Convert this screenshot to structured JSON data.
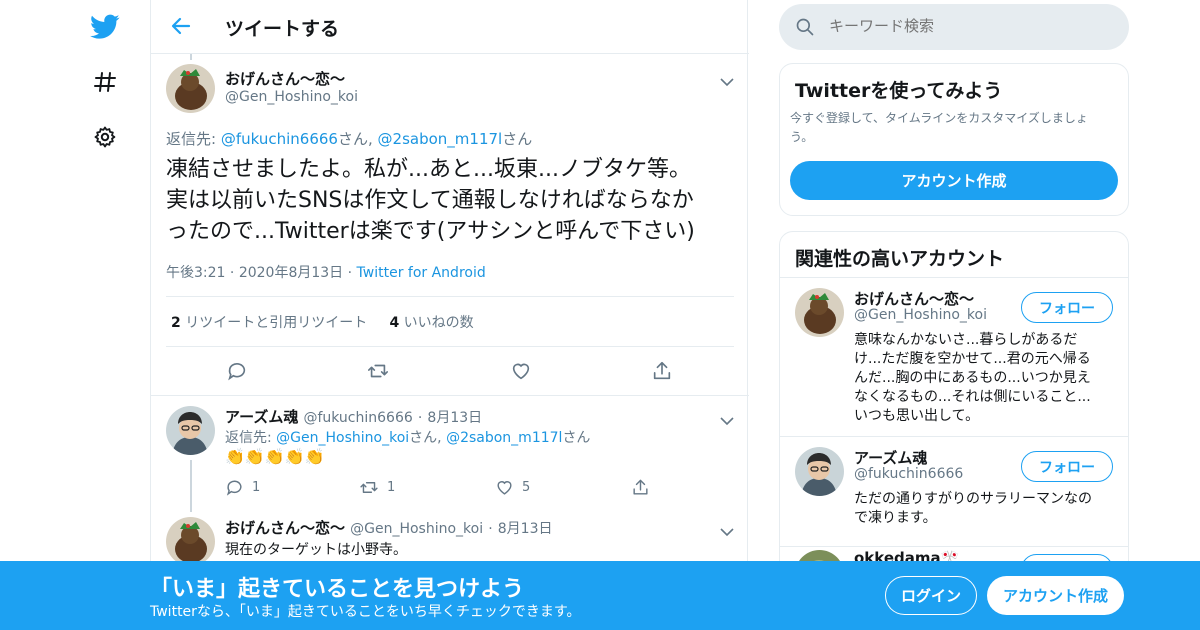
{
  "colors": {
    "accent": "#1da1f2",
    "link": "#1b95e0",
    "muted": "#657786",
    "border": "#e6ecf0"
  },
  "nav": {
    "icons": [
      "twitter-bird-icon",
      "hashtag-icon",
      "gear-icon"
    ]
  },
  "header": {
    "title": "ツイートする"
  },
  "focus_tweet": {
    "name": "おげんさん〜恋〜",
    "handle": "@Gen_Hoshino_koi",
    "reply_label": "返信先:",
    "reply_user1": "@fukuchin6666",
    "reply_sep": "さん,",
    "reply_user2": "@2sabon_m117l",
    "reply_suffix": "さん",
    "text_line1": "凍結させましたよ。私が...あと...坂東...ノブタケ等。",
    "text_line2": "実は以前いたSNSは作文して通報しなければならなか",
    "text_line3": "ったので...Twitterは楽です(アサシンと呼んで下さい)",
    "time": "午後3:21",
    "date": "2020年8月13日",
    "dot": "·",
    "source": "Twitter for Android",
    "retweet_count": "2",
    "retweet_label": "リツイートと引用リツイート",
    "like_count": "4",
    "like_label": "いいねの数"
  },
  "replies": [
    {
      "name": "アーズム魂",
      "handle": "@fukuchin6666",
      "date": "8月13日",
      "reply_label": "返信先:",
      "reply_user1": "@Gen_Hoshino_koi",
      "reply_sep": "さん,",
      "reply_user2": "@2sabon_m117l",
      "reply_suffix": "さん",
      "text": "👏👏👏👏👏",
      "reply_count": "1",
      "retweet_count": "1",
      "like_count": "5"
    },
    {
      "name": "おげんさん〜恋〜",
      "handle": "@Gen_Hoshino_koi",
      "date": "8月13日",
      "text": "現在のターゲットは小野寺。"
    }
  ],
  "search": {
    "placeholder": "キーワード検索"
  },
  "signup_card": {
    "title": "Twitterを使ってみよう",
    "description_line1": "今すぐ登録して、タイムラインをカスタマイズしましょ",
    "description_line2": "う。",
    "button": "アカウント作成"
  },
  "related": {
    "title": "関連性の高いアカウント",
    "follow_label": "フォロー",
    "accounts": [
      {
        "name": "おげんさん〜恋〜",
        "handle": "@Gen_Hoshino_koi",
        "bio_lines": [
          "意味なんかないさ...暮らしがあるだ",
          "け...ただ腹を空かせて...君の元へ帰る",
          "んだ...胸の中にあるもの...いつか見え",
          "なくなるもの...それは側にいること...",
          "いつも思い出して。"
        ]
      },
      {
        "name": "アーズム魂",
        "handle": "@fukuchin6666",
        "bio_lines": [
          "ただの通りすがりのサラリーマンなの",
          "で凍ります。"
        ]
      },
      {
        "name": "okkedama🎌",
        "handle": ""
      }
    ]
  },
  "banner": {
    "title": "「いま」起きていることを見つけよう",
    "subtitle": "Twitterなら、「いま」起きていることをいち早くチェックできます。",
    "login": "ログイン",
    "signup": "アカウント作成"
  }
}
